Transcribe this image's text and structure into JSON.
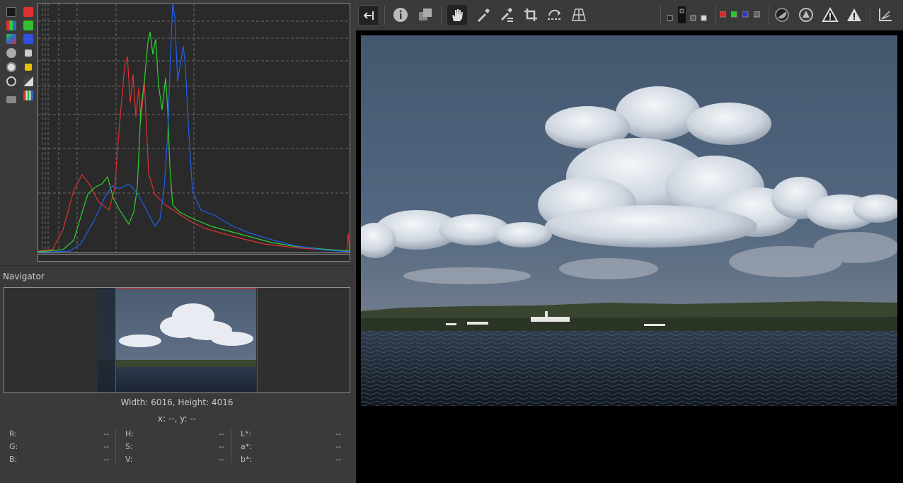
{
  "navigator": {
    "title": "Navigator",
    "dimensions": "Width: 6016, Height: 4016",
    "coords": "x: --, y: --"
  },
  "info": {
    "col1": [
      {
        "label": "R:",
        "value": "--"
      },
      {
        "label": "G:",
        "value": "--"
      },
      {
        "label": "B:",
        "value": "--"
      }
    ],
    "col2": [
      {
        "label": "H:",
        "value": "--"
      },
      {
        "label": "S:",
        "value": "--"
      },
      {
        "label": "V:",
        "value": "--"
      }
    ],
    "col3": [
      {
        "label": "L*:",
        "value": "--"
      },
      {
        "label": "a*:",
        "value": "--"
      },
      {
        "label": "b*:",
        "value": "--"
      }
    ]
  },
  "histogram": {
    "channels": [
      "red",
      "green",
      "blue"
    ],
    "colors": {
      "red": "#e03030",
      "green": "#30d030",
      "blue": "#2060f0"
    }
  },
  "toolbar_icons": [
    "hide-panel-icon",
    "info-icon",
    "before-after-icon",
    "hand-icon",
    "color-picker-icon",
    "white-balance-picker-icon",
    "crop-icon",
    "straighten-icon",
    "perspective-icon",
    "preview-background-icon",
    "red-channel-icon",
    "green-channel-icon",
    "blue-channel-icon",
    "luminance-icon",
    "focus-mask-icon",
    "shadow-clipping-icon",
    "highlight-clipping-icon",
    "color-management-icon"
  ]
}
